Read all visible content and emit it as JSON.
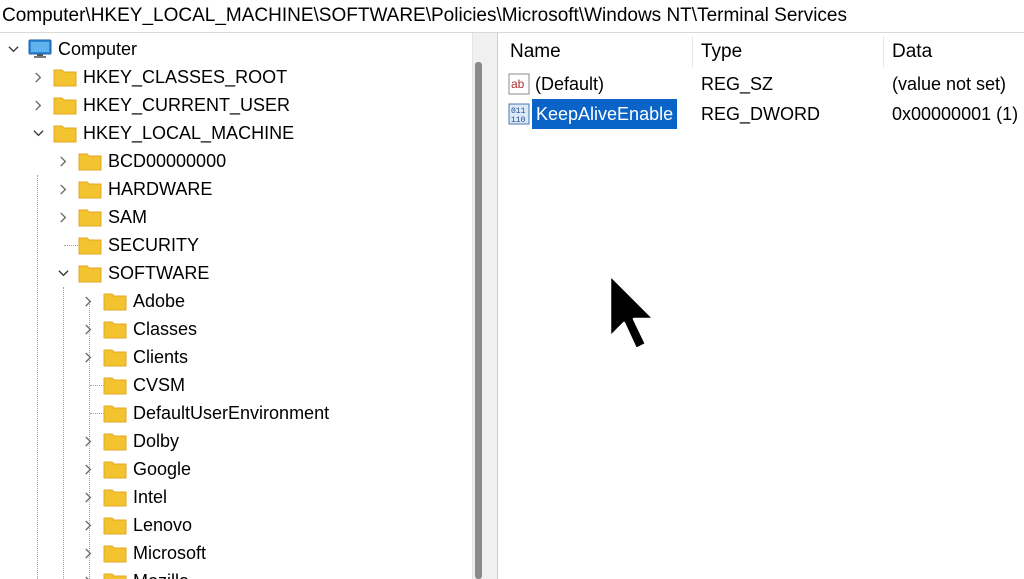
{
  "address_bar": {
    "path": "Computer\\HKEY_LOCAL_MACHINE\\SOFTWARE\\Policies\\Microsoft\\Windows NT\\Terminal Services"
  },
  "tree": {
    "root": "Computer",
    "hives": [
      "HKEY_CLASSES_ROOT",
      "HKEY_CURRENT_USER",
      "HKEY_LOCAL_MACHINE"
    ],
    "hklm_children": [
      "BCD00000000",
      "HARDWARE",
      "SAM",
      "SECURITY",
      "SOFTWARE"
    ],
    "software_children": [
      "Adobe",
      "Classes",
      "Clients",
      "CVSM",
      "DefaultUserEnvironment",
      "Dolby",
      "Google",
      "Intel",
      "Lenovo",
      "Microsoft",
      "Mozilla"
    ]
  },
  "list": {
    "columns": {
      "name": "Name",
      "type": "Type",
      "data": "Data"
    },
    "rows": [
      {
        "name": "(Default)",
        "type": "REG_SZ",
        "data": "(value not set)",
        "icon": "string-value-icon"
      },
      {
        "name": "KeepAliveEnable",
        "type": "REG_DWORD",
        "data": "0x00000001 (1)",
        "icon": "dword-value-icon",
        "selected": true
      }
    ]
  },
  "colors": {
    "selection": "#0a64c8",
    "folder": "#f4c430",
    "folder_dark": "#e0a820"
  }
}
